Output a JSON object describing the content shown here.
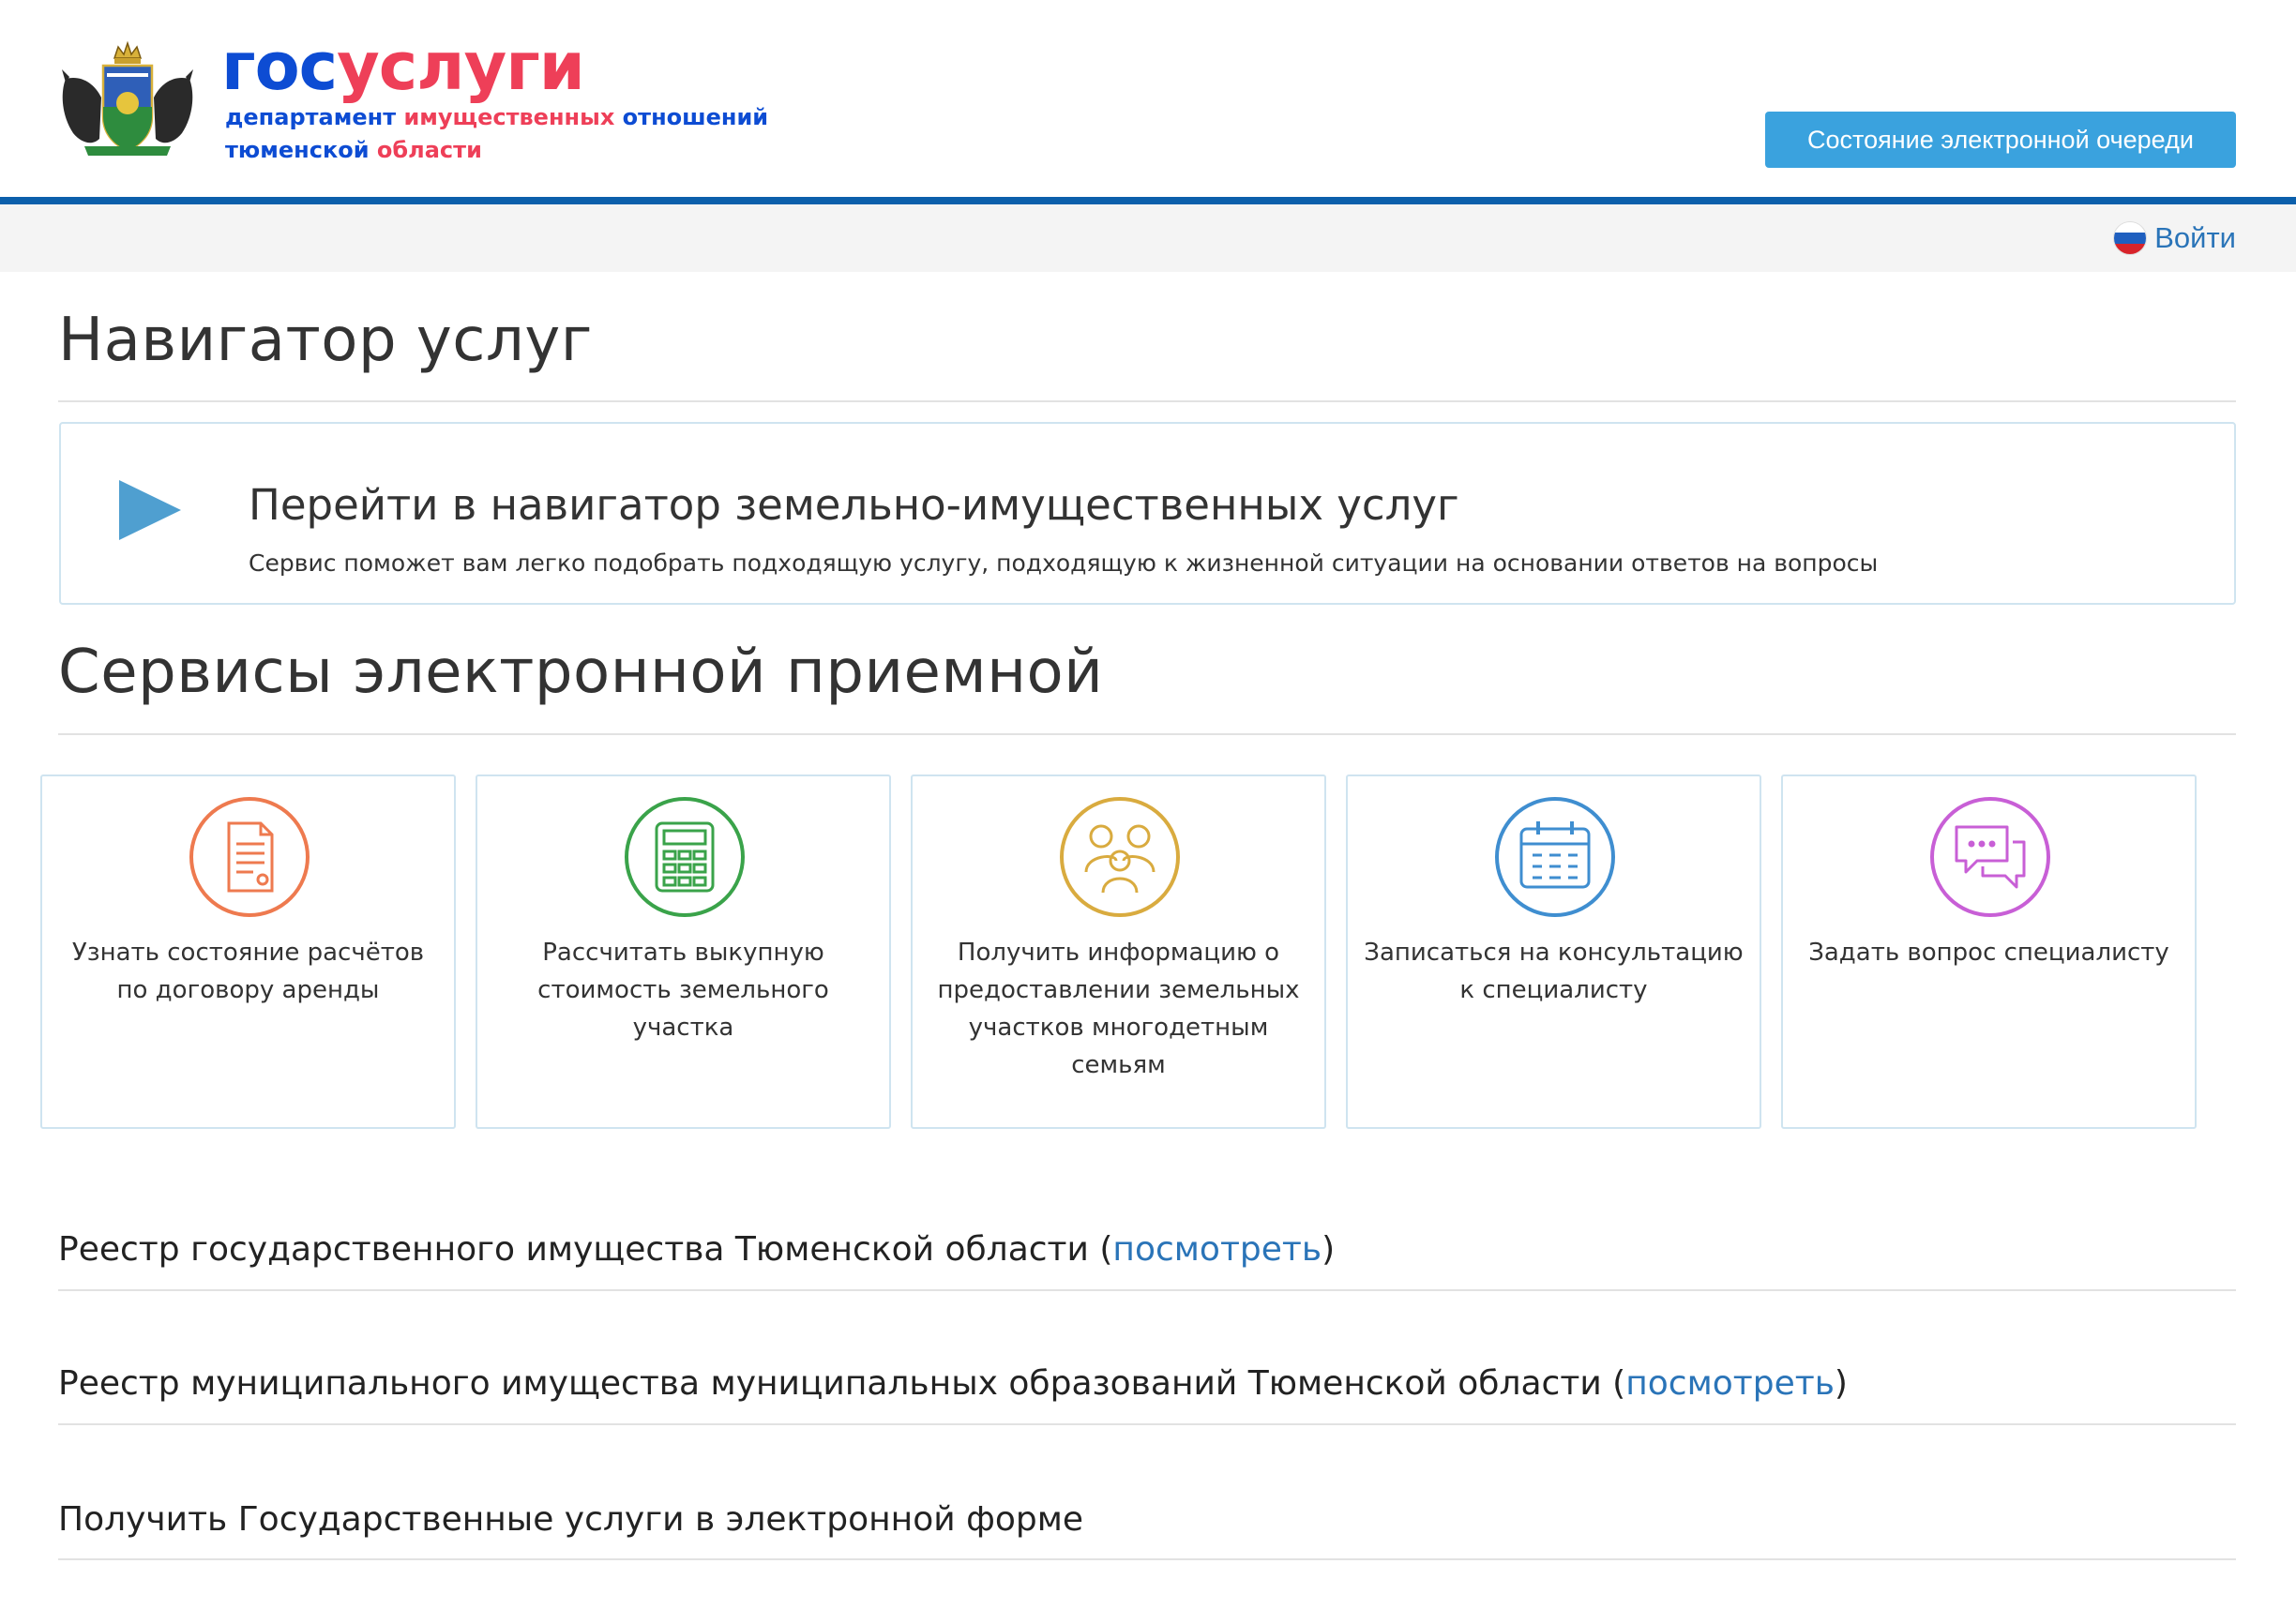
{
  "header": {
    "brand_gos": "гос",
    "brand_uslugi": "услуги",
    "sub1_a": "департамент",
    "sub1_b": "имущественных",
    "sub1_c": "отношений",
    "sub2_a": "тюменской",
    "sub2_b": "области",
    "emblem_icon": "coat-of-arms-icon",
    "queue_button": "Состояние электронной очереди",
    "login_label": "Войти",
    "login_icon": "russian-flag-icon"
  },
  "colors": {
    "brand_blue": "#0d4cd3",
    "brand_red": "#ee3f58",
    "accent_line": "#0b5fab",
    "button": "#3aa2de",
    "link": "#2a74b8"
  },
  "navigator": {
    "heading": "Навигатор услуг",
    "box_title": "Перейти в навигатор земельно-имущественных услуг",
    "box_desc": "Сервис поможет вам легко подобрать подходящую услугу, подходящую к жизненной ситуации на основании ответов на вопросы",
    "box_icon": "play-icon"
  },
  "services": {
    "heading": "Сервисы электронной приемной",
    "cards": [
      {
        "label": "Узнать состояние расчётов по договору аренды",
        "icon": "document-icon",
        "color": "#ee7a4f"
      },
      {
        "label": "Рассчитать выкупную стоимость земельного участка",
        "icon": "calculator-icon",
        "color": "#3aa34a"
      },
      {
        "label": "Получить информацию о предоставлении земельных участков многодетным семьям",
        "icon": "family-icon",
        "color": "#d9ab3f"
      },
      {
        "label": "Записаться на консультацию к специалисту",
        "icon": "calendar-icon",
        "color": "#3f8ed0"
      },
      {
        "label": "Задать вопрос специалисту",
        "icon": "chat-icon",
        "color": "#c85fd6"
      }
    ]
  },
  "registries": [
    {
      "text": "Реестр государственного имущества Тюменской области (",
      "link": "посмотреть",
      "close": ")"
    },
    {
      "text": "Реестр муниципального имущества муниципальных образований Тюменской области (",
      "link": "посмотреть",
      "close": ")"
    },
    {
      "text": "Получить Государственные услуги в электронной форме",
      "link": "",
      "close": ""
    }
  ]
}
